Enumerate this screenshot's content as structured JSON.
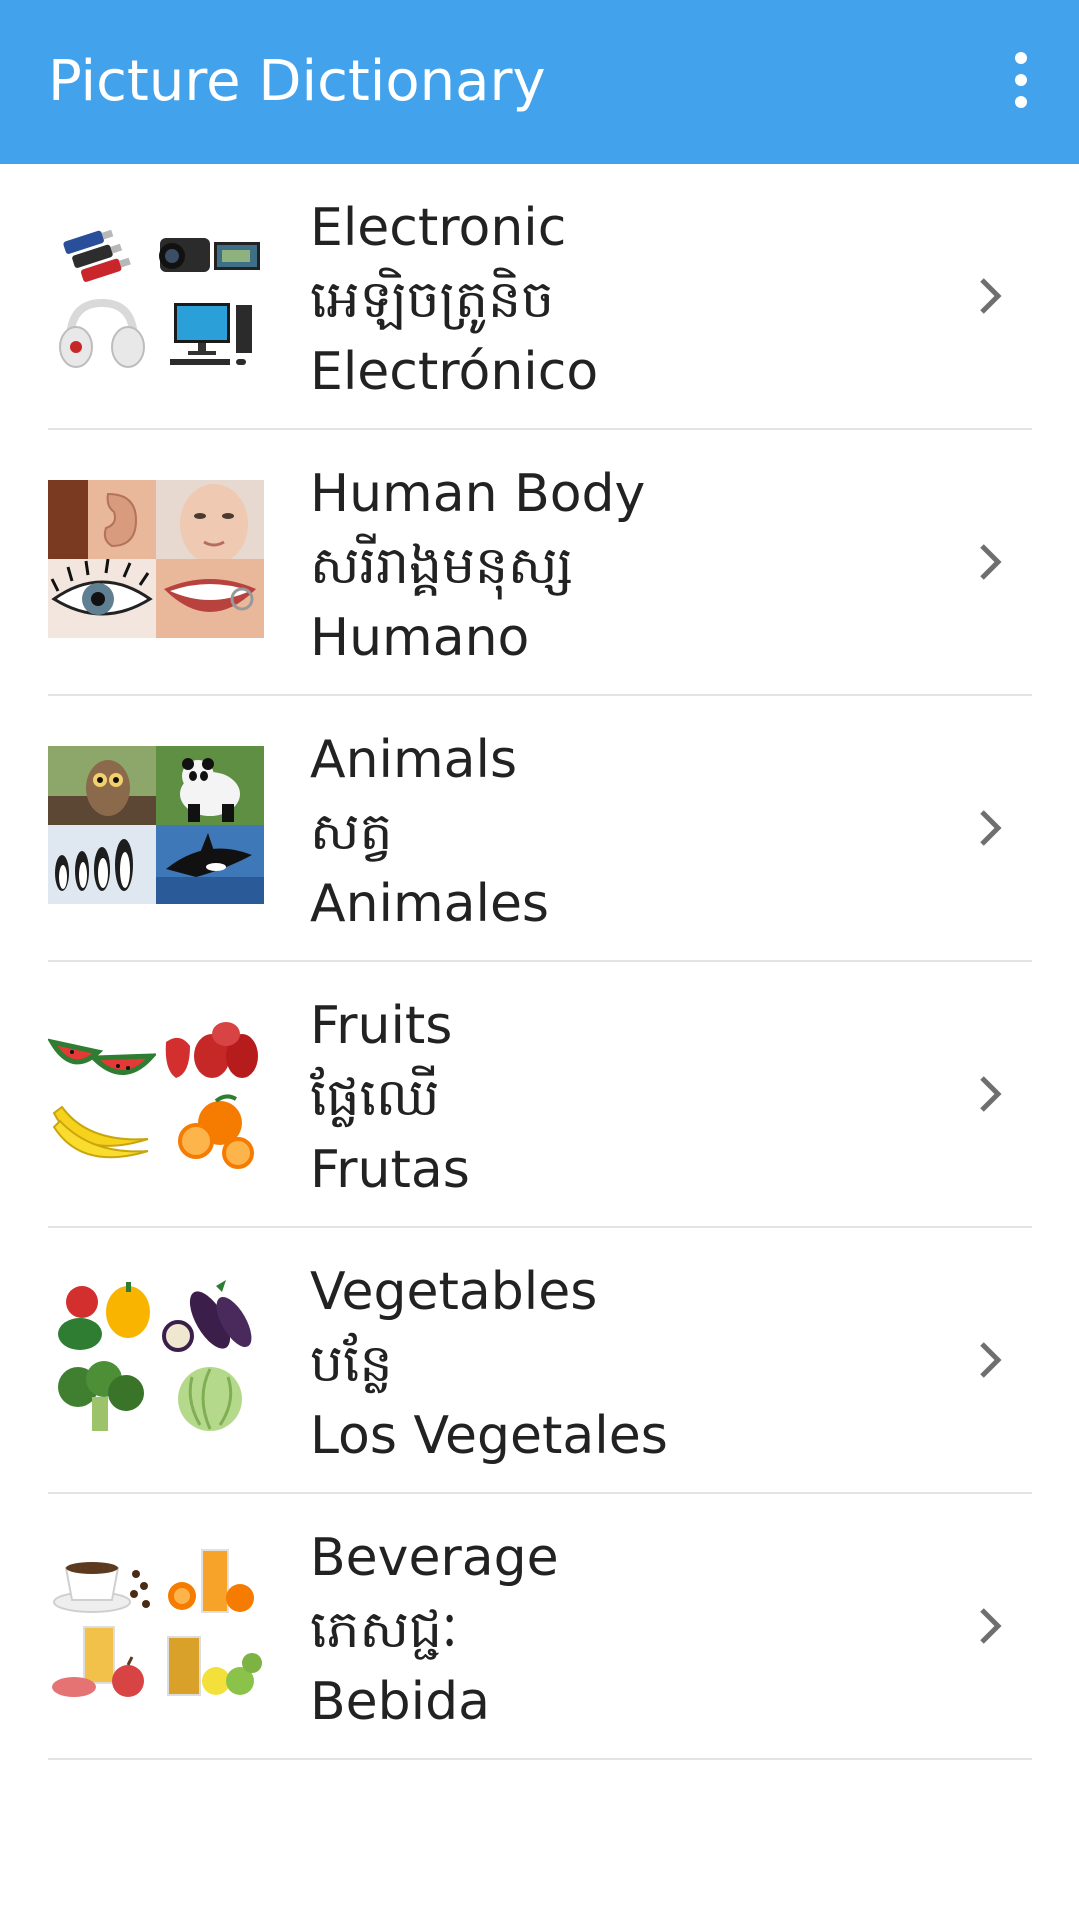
{
  "app": {
    "title": "Picture Dictionary",
    "menu_icon": "more-vertical-icon",
    "bar_color": "#42a2ec"
  },
  "categories": [
    {
      "english": "Electronic",
      "khmer": "អេឡិចត្រូនិច",
      "spanish": "Electrónico",
      "thumb_icons": [
        "usb-drives-icon",
        "camcorder-icon",
        "headphones-icon",
        "desktop-computer-icon"
      ]
    },
    {
      "english": "Human Body",
      "khmer": "សរីរាង្គមនុស្ស",
      "spanish": "Humano",
      "thumb_icons": [
        "ear-icon",
        "face-icon",
        "eye-icon",
        "teeth-icon"
      ]
    },
    {
      "english": "Animals",
      "khmer": "សត្វ",
      "spanish": "Animales",
      "thumb_icons": [
        "owl-icon",
        "panda-icon",
        "penguins-icon",
        "orca-icon"
      ]
    },
    {
      "english": "Fruits",
      "khmer": "ផ្លែឈើ",
      "spanish": "Frutas",
      "thumb_icons": [
        "watermelon-icon",
        "rose-apple-icon",
        "banana-icon",
        "orange-icon"
      ]
    },
    {
      "english": "Vegetables",
      "khmer": "បន្លែ",
      "spanish": "Los Vegetales",
      "thumb_icons": [
        "bell-pepper-icon",
        "eggplant-icon",
        "broccoli-icon",
        "cabbage-icon"
      ]
    },
    {
      "english": "Beverage",
      "khmer": "ភេសជ្ជៈ",
      "spanish": "Bebida",
      "thumb_icons": [
        "coffee-cup-icon",
        "orange-juice-icon",
        "apple-juice-icon",
        "iced-tea-icon"
      ]
    }
  ]
}
